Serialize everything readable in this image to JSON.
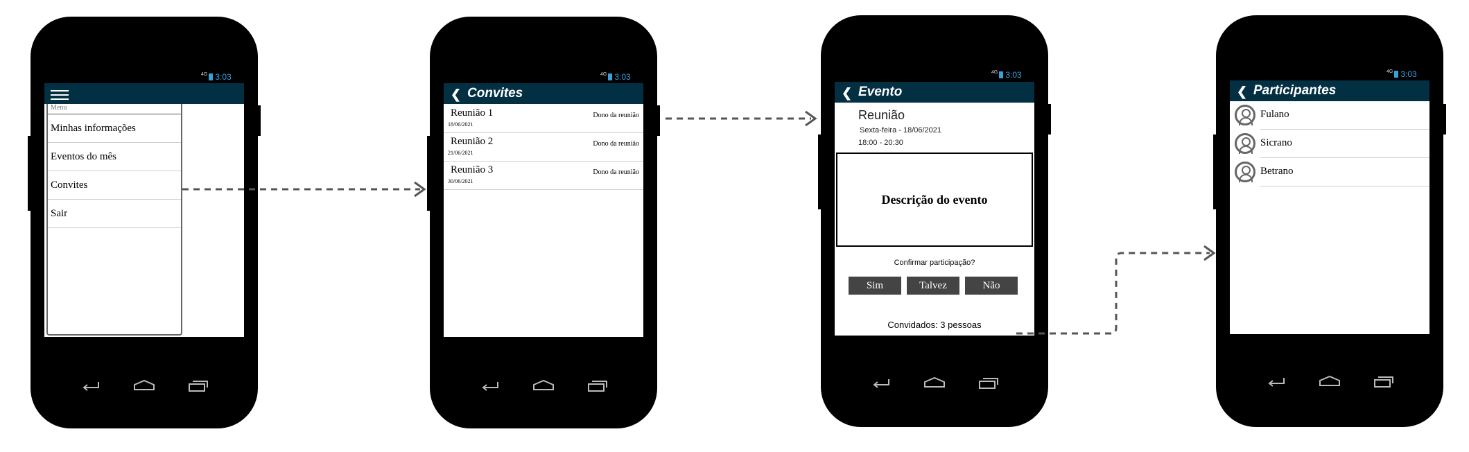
{
  "status": {
    "network": "4G",
    "time": "3:03"
  },
  "screen1": {
    "menu_header": "Menu",
    "items": [
      {
        "label": "Minhas informações"
      },
      {
        "label": "Eventos do mês"
      },
      {
        "label": "Convites"
      },
      {
        "label": "Sair"
      }
    ]
  },
  "screen2": {
    "title": "Convites",
    "invites": [
      {
        "name": "Reunião 1",
        "date": "18/06/2021",
        "role": "Dono da reunião"
      },
      {
        "name": "Reunião 2",
        "date": "21/06/2021",
        "role": "Dono da reunião"
      },
      {
        "name": "Reunião 3",
        "date": "30/06/2021",
        "role": "Dono da reunião"
      }
    ]
  },
  "screen3": {
    "title": "Evento",
    "event_name": "Reunião",
    "event_date": "Sexta-feira - 18/06/2021",
    "event_time": "18:00 - 20:30",
    "description": "Descrição do evento",
    "confirm_question": "Confirmar participação?",
    "buttons": {
      "yes": "Sim",
      "maybe": "Talvez",
      "no": "Não"
    },
    "guests": "Convidados: 3 pessoas"
  },
  "screen4": {
    "title": "Participantes",
    "participants": [
      {
        "name": "Fulano"
      },
      {
        "name": "Sicrano"
      },
      {
        "name": "Betrano"
      }
    ]
  },
  "colors": {
    "appbar": "#032f43",
    "status_accent": "#3aa0d8",
    "button": "#444444",
    "arrow": "#555555"
  }
}
